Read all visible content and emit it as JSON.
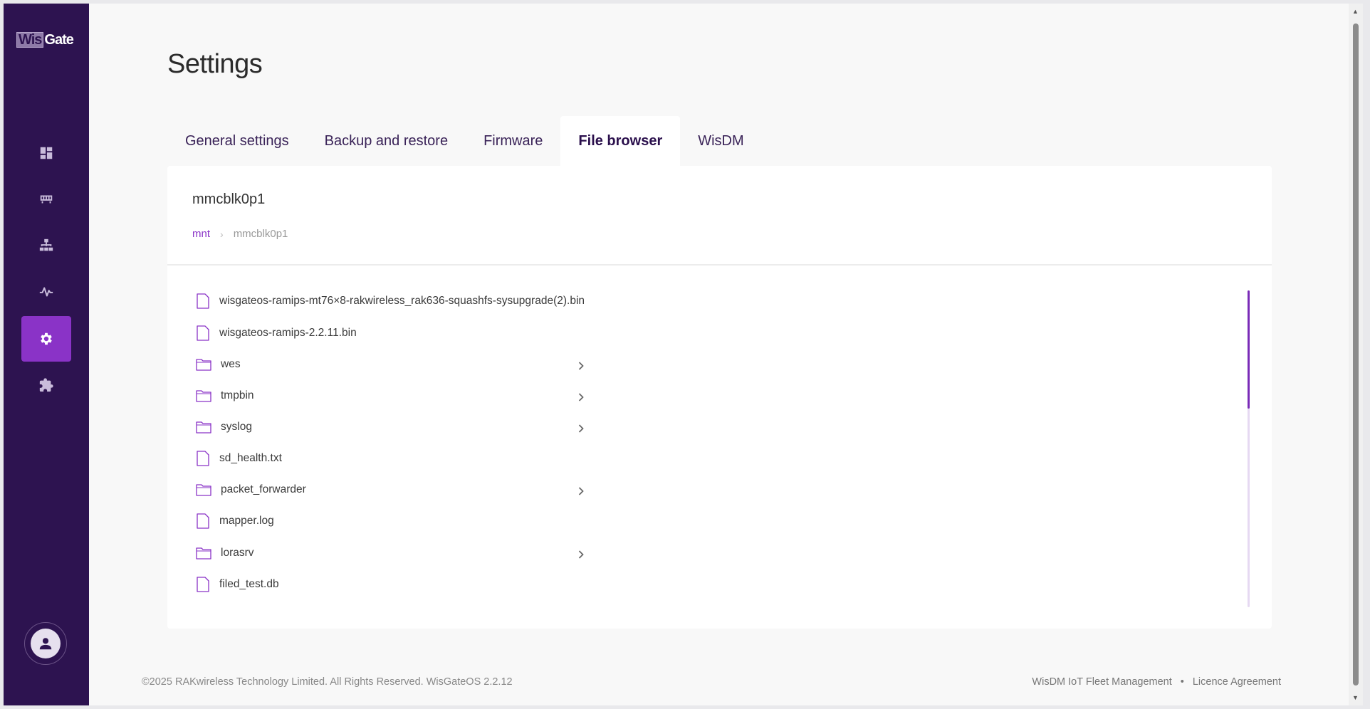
{
  "sidebar": {
    "logo_part1": "Wis",
    "logo_part2": "Gate",
    "items": [
      {
        "name": "dashboard-icon"
      },
      {
        "name": "gateway-icon"
      },
      {
        "name": "network-icon"
      },
      {
        "name": "activity-icon"
      },
      {
        "name": "gear-icon",
        "active": true
      },
      {
        "name": "puzzle-icon"
      }
    ],
    "avatar_icon": "user-icon"
  },
  "page": {
    "title": "Settings"
  },
  "tabs": [
    {
      "label": "General settings"
    },
    {
      "label": "Backup and restore"
    },
    {
      "label": "Firmware"
    },
    {
      "label": "File browser",
      "active": true
    },
    {
      "label": "WisDM"
    }
  ],
  "browser": {
    "folder_title": "mmcblk0p1",
    "breadcrumb": {
      "parent": "mnt",
      "current": "mmcblk0p1"
    },
    "entries": [
      {
        "name": "wisgateos-ramips-mt76×8-rakwireless_rak636-squashfs-sysupgrade(2).bin",
        "type": "file"
      },
      {
        "name": "wisgateos-ramips-2.2.11.bin",
        "type": "file"
      },
      {
        "name": "wes",
        "type": "folder"
      },
      {
        "name": "tmpbin",
        "type": "folder"
      },
      {
        "name": "syslog",
        "type": "folder"
      },
      {
        "name": "sd_health.txt",
        "type": "file"
      },
      {
        "name": "packet_forwarder",
        "type": "folder"
      },
      {
        "name": "mapper.log",
        "type": "file"
      },
      {
        "name": "lorasrv",
        "type": "folder"
      },
      {
        "name": "filed_test.db",
        "type": "file"
      }
    ]
  },
  "footer": {
    "copyright": "©2025 RAKwireless Technology Limited. All Rights Reserved. WisGateOS 2.2.12",
    "link1": "WisDM IoT Fleet Management",
    "separator": "•",
    "link2": "Licence Agreement"
  },
  "colors": {
    "sidebar_bg": "#2d1350",
    "accent": "#8a33c7",
    "tab_text": "#3a2358"
  }
}
